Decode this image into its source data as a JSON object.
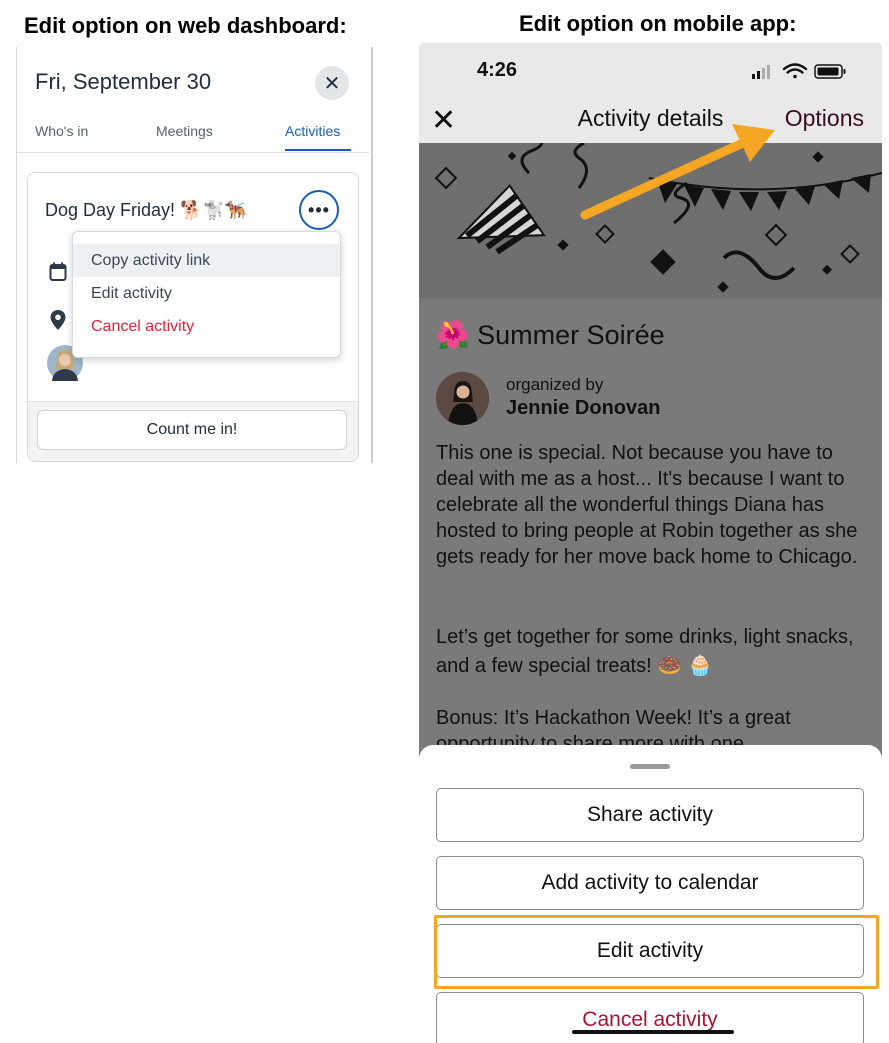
{
  "captions": {
    "web": "Edit option on web dashboard:",
    "mobile": "Edit option on mobile app:"
  },
  "web": {
    "date": "Fri, September 30",
    "tabs": [
      "Who's in",
      "Meetings",
      "Activities"
    ],
    "active_tab": "Activities",
    "card": {
      "title": "Dog Day Friday! 🐕🐩🐕‍🦺",
      "more_label": "•••",
      "menu": [
        "Copy activity link",
        "Edit activity",
        "Cancel activity"
      ],
      "count_button": "Count me in!"
    },
    "colors": {
      "accent": "#1b5db3",
      "danger": "#e0243a"
    }
  },
  "mobile": {
    "time": "4:26",
    "nav": {
      "close": "✕",
      "title": "Activity details",
      "options": "Options"
    },
    "title": "🌺 Summer Soirée",
    "organizer": {
      "label": "organized by",
      "name": "Jennie Donovan"
    },
    "paragraphs": [
      "This one is special. Not because you have to deal with me as a host... It's because I want to celebrate all the wonderful things Diana has hosted to bring people at Robin together as she gets ready for her move back home to Chicago.",
      "Let’s get together for some drinks, light snacks, and a few special treats! 🍩 🧁",
      "Bonus: It’s Hackathon Week! It’s a great opportunity to share more with one"
    ],
    "sheet_buttons": [
      "Share activity",
      "Add activity to calendar",
      "Edit activity",
      "Cancel activity"
    ],
    "colors": {
      "highlight": "#f5a623",
      "danger": "#a61530",
      "options": "#3a0a22"
    }
  }
}
